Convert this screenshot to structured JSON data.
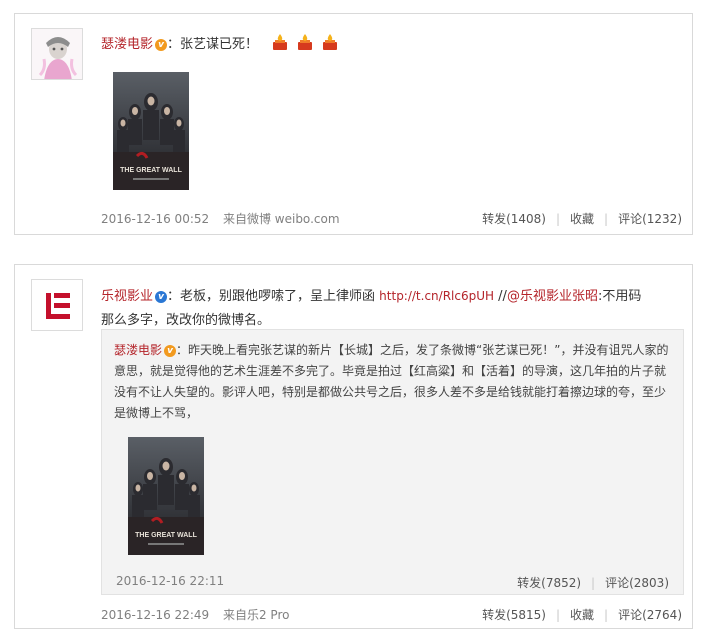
{
  "post1": {
    "author": "瑟溇电影",
    "colon": "：",
    "text": "张艺谋已死！",
    "emoji": [
      "candle-icon",
      "candle-icon",
      "candle-icon"
    ],
    "poster_title": "THE GREAT WALL",
    "time": "2016-12-16 00:52",
    "source": "来自微博 weibo.com",
    "actions": {
      "forward": "转发(1408)",
      "favorite": "收藏",
      "comment": "评论(1232)"
    }
  },
  "post2": {
    "author": "乐视影业",
    "colon": "：",
    "text_a": "老板，别跟他啰嗦了，呈上律师函 ",
    "link": "http://t.cn/Rlc6pUH",
    "sep": " //",
    "mention": "@乐视影业张昭",
    "text_b": ":不用码",
    "line2": "那么多字，改改你的微博名。",
    "repost": {
      "author": "瑟溇电影",
      "colon": "：",
      "line1": "昨天晚上看完张艺谋的新片【长城】之后，发了条微博“张艺谋已死！”，并没有诅咒人家的",
      "line2": "意思，就是觉得他的艺术生涯差不多完了。毕竟是拍过【红高粱】和【活着】的导演，这几年拍的片子就",
      "line3": "没有不让人失望的。影评人吧，特别是都做公共号之后，很多人差不多是给钱就能打着擦边球的夸，至少",
      "line4": "是微博上不骂，",
      "poster_title": "THE GREAT WALL",
      "time": "2016-12-16 22:11",
      "actions": {
        "forward": "转发(7852)",
        "comment": "评论(2803)"
      }
    },
    "time": "2016-12-16 22:49",
    "source": "来自乐2 Pro",
    "actions": {
      "forward": "转发(5815)",
      "favorite": "收藏",
      "comment": "评论(2764)"
    }
  },
  "colors": {
    "name": "#b4242a",
    "verified_orange": "#f29a1f",
    "verified_blue": "#2a77d4",
    "letv_red": "#c4102c"
  }
}
